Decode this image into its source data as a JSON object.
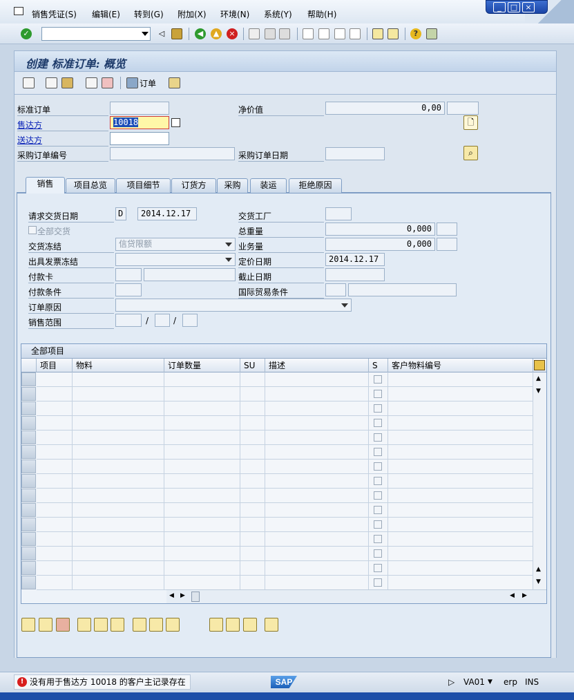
{
  "menu": {
    "items": [
      "销售凭证(S)",
      "编辑(E)",
      "转到(G)",
      "附加(X)",
      "环境(N)",
      "系统(Y)",
      "帮助(H)"
    ]
  },
  "window_controls": {
    "minimize": "_",
    "maximize": "□",
    "close": "×"
  },
  "toolbar": {
    "command_field_value": "",
    "icons": [
      "enter-icon",
      "back-icon",
      "save-icon",
      "back-arrow-icon",
      "exit-icon",
      "cancel-icon",
      "print-icon",
      "find-icon",
      "find-next-icon",
      "first-page-icon",
      "prev-page-icon",
      "next-page-icon",
      "last-page-icon",
      "new-session-icon",
      "shortcut-icon",
      "help-icon",
      "layout-icon"
    ]
  },
  "title": "创建 标准订单: 概览",
  "app_toolbar": {
    "order_button_label": "订单"
  },
  "header": {
    "std_order_label": "标准订单",
    "std_order_value": "",
    "net_value_label": "净价值",
    "net_value": "0,00",
    "net_value_currency": "",
    "sold_to_label": "售达方",
    "sold_to_value": "10018",
    "ship_to_label": "送达方",
    "ship_to_value": "",
    "po_number_label": "采购订单编号",
    "po_number_value": "",
    "po_date_label": "采购订单日期",
    "po_date_value": ""
  },
  "tabs": [
    "销售",
    "项目总览",
    "项目细节",
    "订货方",
    "采购",
    "装运",
    "拒绝原因"
  ],
  "sales_tab": {
    "req_delivery_date_label": "请求交货日期",
    "req_delivery_date_type": "D",
    "req_delivery_date": "2014.12.17",
    "delivering_plant_label": "交货工厂",
    "complete_delivery_label": "全部交货",
    "total_weight_label": "总重量",
    "total_weight": "0,000",
    "delivery_block_label": "交货冻结",
    "delivery_block_value": "信贷限额",
    "volume_label": "业务量",
    "volume": "0,000",
    "billing_block_label": "出具发票冻结",
    "pricing_date_label": "定价日期",
    "pricing_date": "2014.12.17",
    "payment_card_label": "付款卡",
    "expiry_date_label": "截止日期",
    "payment_terms_label": "付款条件",
    "incoterms_label": "国际贸易条件",
    "order_reason_label": "订单原因",
    "sales_area_label": "销售范围",
    "sales_area_sep": "/"
  },
  "items_table": {
    "title": "全部项目",
    "columns": [
      "项目",
      "物料",
      "订单数量",
      "SU",
      "描述",
      "S",
      "客户物料编号"
    ],
    "empty_rows": 15
  },
  "status": {
    "message": "没有用于售达方 10018 的客户主记录存在",
    "logo": "SAP",
    "transaction": "VA01",
    "system": "erp",
    "mode": "INS"
  },
  "colors": {
    "link": "#0b24b8",
    "error": "#d81e1e",
    "focus_field": "#fff7a8"
  }
}
